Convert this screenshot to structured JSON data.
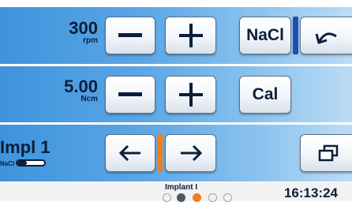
{
  "speed": {
    "value": "300",
    "unit": "rpm"
  },
  "torque": {
    "value": "5.00",
    "unit": "Ncm"
  },
  "implant": {
    "label": "Impl 1",
    "indicator_label": "NaCl"
  },
  "buttons": {
    "nacl_label": "NaCl",
    "cal_label": "Cal"
  },
  "status": {
    "program_name": "Implant I",
    "time": "16:13:24",
    "active_step": 3,
    "step_count": 5
  },
  "colors": {
    "accent_orange": "#f07e1c",
    "active_blue": "#1d4fb0",
    "row_blue": "#3f93dc"
  }
}
